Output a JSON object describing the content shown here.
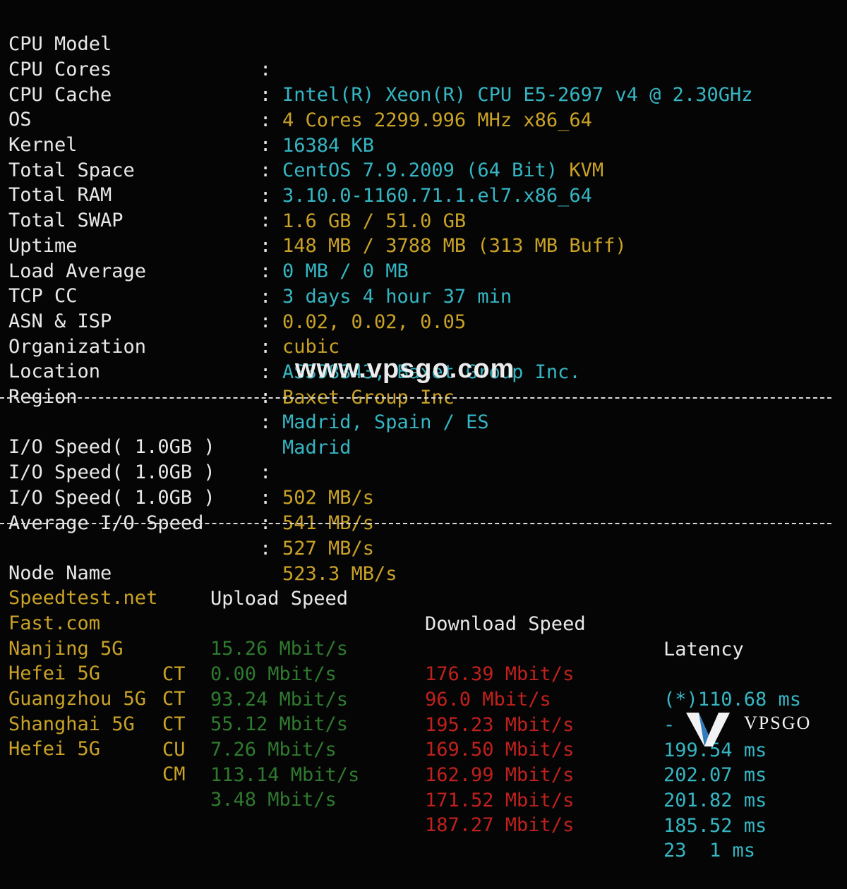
{
  "system_info": [
    {
      "label": "CPU Model",
      "value": "Intel(R) Xeon(R) CPU E5-2697 v4 @ 2.30GHz",
      "color": "cyan"
    },
    {
      "label": "CPU Cores",
      "value": "4 Cores 2299.996 MHz x86_64",
      "color": "yellow"
    },
    {
      "label": "CPU Cache",
      "value": "16384 KB",
      "color": "cyan"
    },
    {
      "label": "OS",
      "value": "CentOS 7.9.2009 (64 Bit)",
      "value2": "KVM",
      "color": "cyan"
    },
    {
      "label": "Kernel",
      "value": "3.10.0-1160.71.1.el7.x86_64",
      "color": "cyan"
    },
    {
      "label": "Total Space",
      "value": "1.6 GB / 51.0 GB",
      "color": "yellow"
    },
    {
      "label": "Total RAM",
      "value": "148 MB / 3788 MB (313 MB Buff)",
      "color": "yellow"
    },
    {
      "label": "Total SWAP",
      "value": "0 MB / 0 MB",
      "color": "cyan"
    },
    {
      "label": "Uptime",
      "value": "3 days 4 hour 37 min",
      "color": "cyan"
    },
    {
      "label": "Load Average",
      "value": "0.02, 0.02, 0.05",
      "color": "yellow"
    },
    {
      "label": "TCP CC",
      "value": "cubic",
      "color": "yellow"
    },
    {
      "label": "ASN & ISP",
      "value": "AS398343, Baxet Group Inc.",
      "color": "cyan"
    },
    {
      "label": "Organization",
      "value": "Baxet Group Inc",
      "color": "yellow"
    },
    {
      "label": "Location",
      "value": "Madrid, Spain / ES",
      "color": "cyan"
    },
    {
      "label": "Region",
      "value": "Madrid",
      "color": "cyan"
    }
  ],
  "separator": ":",
  "io": [
    {
      "label": "I/O Speed( 1.0GB )",
      "value": "502 MB/s"
    },
    {
      "label": "I/O Speed( 1.0GB )",
      "value": "541 MB/s"
    },
    {
      "label": "I/O Speed( 1.0GB )",
      "value": "527 MB/s"
    },
    {
      "label": "Average I/O Speed",
      "value": "523.3 MB/s"
    }
  ],
  "speedtest": {
    "headers": {
      "node": "Node Name",
      "upload": "Upload Speed",
      "download": "Download Speed",
      "latency": "Latency"
    },
    "rows": [
      {
        "node": "Speedtest.net",
        "isp": "",
        "upload": "15.26 Mbit/s",
        "download": "176.39 Mbit/s",
        "latency": "(*)110.68 ms"
      },
      {
        "node": "Fast.com",
        "isp": "",
        "upload": "0.00 Mbit/s",
        "download": "96.0 Mbit/s",
        "latency": "-"
      },
      {
        "node": "Nanjing 5G",
        "isp": "CT",
        "upload": "93.24 Mbit/s",
        "download": "195.23 Mbit/s",
        "latency": "199.54 ms"
      },
      {
        "node": "Hefei 5G",
        "isp": "CT",
        "upload": "55.12 Mbit/s",
        "download": "169.50 Mbit/s",
        "latency": "202.07 ms"
      },
      {
        "node": "Guangzhou 5G",
        "isp": "CT",
        "upload": "7.26 Mbit/s",
        "download": "162.99 Mbit/s",
        "latency": "201.82 ms"
      },
      {
        "node": "Shanghai 5G",
        "isp": "CU",
        "upload": "113.14 Mbit/s",
        "download": "171.52 Mbit/s",
        "latency": "185.52 ms"
      },
      {
        "node": "Hefei 5G",
        "isp": "CM",
        "upload": "3.48 Mbit/s",
        "download": "187.27 Mbit/s",
        "latency": "23  1 ms"
      }
    ]
  },
  "watermark": "www.vpsgo.com",
  "logo": {
    "text": "VPSGO",
    "icon": "v-logo-icon"
  }
}
